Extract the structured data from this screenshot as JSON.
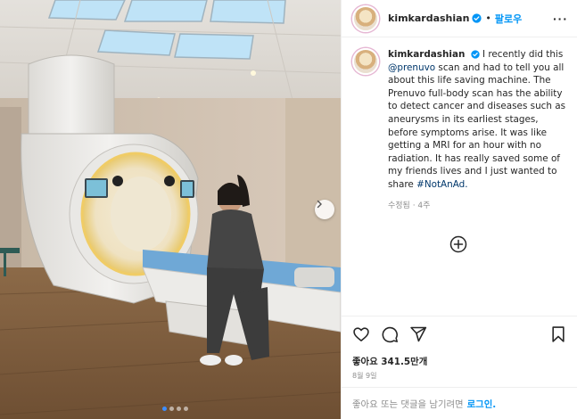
{
  "post": {
    "username": "kimkardashian",
    "follow_label": "팔로우",
    "separator": "•",
    "more_label": "···",
    "caption_user": "kimkardashian",
    "caption_part1": "I recently did this",
    "caption_mention": "@prenuvo",
    "caption_part2": "scan and had to tell you all about this life saving machine. The Prenuvo full-body scan has the ability to detect cancer and diseases such as aneurysms in its earliest stages, before symptoms arise. It was like getting a MRI for an hour with no radiation. It has really saved some of my friends lives and I just wanted to share",
    "caption_hashtag": "#NotAnAd.",
    "edited_meta": "수정됨 · 4주",
    "likes": "좋아요 341.5만개",
    "date": "8월 9일",
    "login_prompt": "좋아요 또는 댓글을 남기려면",
    "login_link": "로그인."
  },
  "icons": {
    "verified": "verified-badge-icon",
    "add_comment": "plus-circle-icon",
    "like": "heart-icon",
    "comment": "comment-bubble-icon",
    "share": "paper-plane-icon",
    "save": "bookmark-icon",
    "next": "chevron-right-icon"
  },
  "carousel": {
    "slides": 4,
    "active_index": 0
  },
  "colors": {
    "accent": "#0095f6",
    "link": "#00376b",
    "muted": "#8e8e8e",
    "text": "#262626",
    "carousel_active": "#3d8eff"
  }
}
